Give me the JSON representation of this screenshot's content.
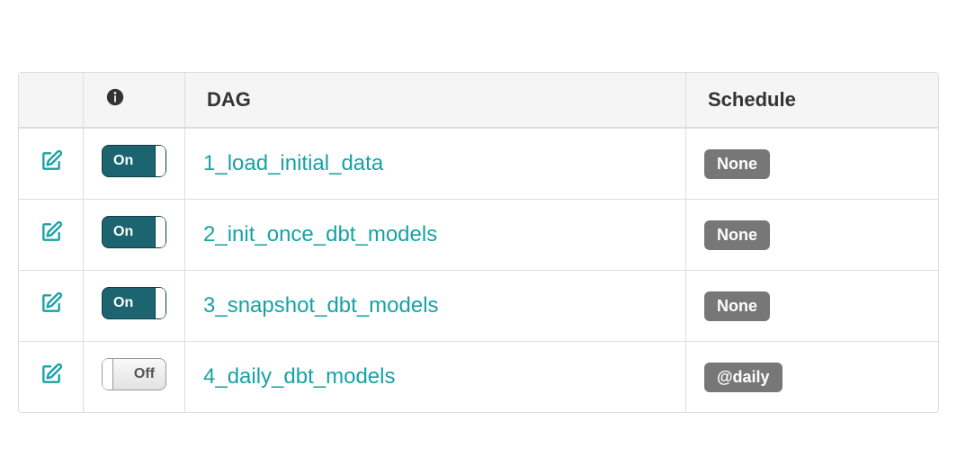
{
  "columns": {
    "edit": "",
    "info": "info-icon",
    "dag": "DAG",
    "schedule": "Schedule"
  },
  "toggle_labels": {
    "on": "On",
    "off": "Off"
  },
  "dags": [
    {
      "name": "1_load_initial_data",
      "on": true,
      "schedule": "None"
    },
    {
      "name": "2_init_once_dbt_models",
      "on": true,
      "schedule": "None"
    },
    {
      "name": "3_snapshot_dbt_models",
      "on": true,
      "schedule": "None"
    },
    {
      "name": "4_daily_dbt_models",
      "on": false,
      "schedule": "@daily"
    }
  ]
}
